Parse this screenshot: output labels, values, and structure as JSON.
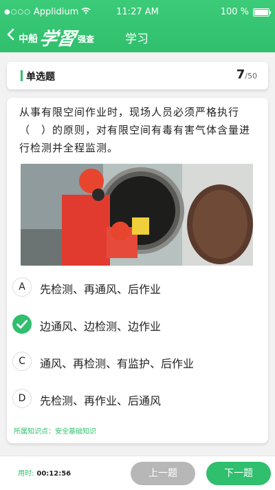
{
  "status": {
    "carrier": "Applidium",
    "time": "11:27 AM",
    "battery_text": "100 %"
  },
  "header": {
    "brand_left": "中船",
    "brand_mid": "学習",
    "brand_right": "强查",
    "title": "学习"
  },
  "question": {
    "type_label": "单选题",
    "current": "7",
    "total": "/50",
    "text": "从事有限空间作业时，现场人员必须严格执行（　）的原则，对有限空间有毒有害气体含量进行检测并全程监测。",
    "options": [
      {
        "key": "A",
        "label": "先检测、再通风、后作业",
        "selected": false
      },
      {
        "key": "B",
        "label": "边通风、边检测、边作业",
        "selected": true
      },
      {
        "key": "C",
        "label": "通风、再检测、有监护、后作业",
        "selected": false
      },
      {
        "key": "D",
        "label": "先检测、再作业、后通风",
        "selected": false
      }
    ],
    "knowledge_label": "所属知识点：安全基础知识"
  },
  "footer": {
    "timer_label": "用时:",
    "timer_value": "00:12:56",
    "prev_label": "上一题",
    "next_label": "下一题"
  },
  "colors": {
    "accent": "#2fbf6d",
    "disabled": "#b7b7b7"
  }
}
